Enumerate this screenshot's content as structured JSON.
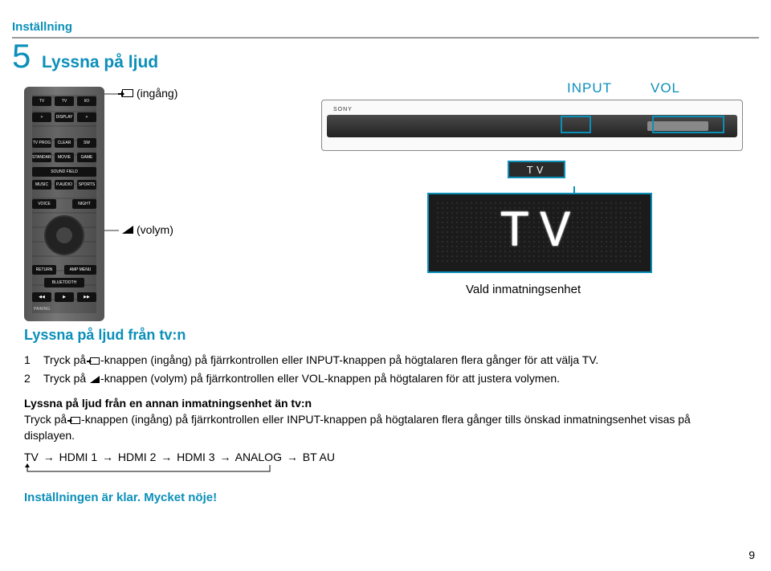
{
  "header": {
    "title": "Inställning"
  },
  "step": {
    "number": "5",
    "title": "Lyssna på ljud"
  },
  "callouts": {
    "input_label": "(ingång)",
    "volume_label": "(volym)"
  },
  "soundbar": {
    "brand": "SONY",
    "label_input": "INPUT",
    "label_vol": "VOL",
    "display_small": "TV",
    "display_big": "TV",
    "caption": "Vald inmatningsenhet"
  },
  "section": {
    "title": "Lyssna på ljud från tv:n",
    "step1_num": "1",
    "step1_lead": "Tryck på ",
    "step1_tail": "-knappen (ingång) på fjärrkontrollen eller INPUT-knappen på högtalaren flera gånger för att välja TV.",
    "step2_num": "2",
    "step2_lead": "Tryck på ",
    "step2_tail": "-knappen (volym) på fjärrkontrollen eller VOL-knappen på högtalaren för att justera volymen.",
    "sub_title": "Lyssna på ljud från en annan inmatningsenhet än tv:n",
    "sub_lead": "Tryck på ",
    "sub_tail": "-knappen (ingång) på fjärrkontrollen eller INPUT-knappen på högtalaren flera gånger tills önskad inmatningsenhet visas på displayen.",
    "sequence": [
      "TV",
      "HDMI 1",
      "HDMI 2",
      "HDMI 3",
      "ANALOG",
      "BT AU"
    ],
    "arrow": "→",
    "done": "Inställningen är klar. Mycket nöje!"
  },
  "remote": {
    "buttons_row1": [
      "TV",
      "TV",
      "I/⏻"
    ],
    "buttons_row2": [
      "+",
      "DISPLAY",
      "+"
    ],
    "buttons_row4": [
      "TV PROG",
      "CLEAR AUDIO+",
      "SW"
    ],
    "buttons_row5": [
      "STANDARD",
      "MOVIE",
      "GAME"
    ],
    "buttons_row6": [
      "",
      "SOUND FIELD",
      ""
    ],
    "buttons_row7": [
      "MUSIC",
      "P.AUDIO",
      "SPORTS"
    ],
    "voice": "VOICE",
    "night": "NIGHT",
    "return_label": "RETURN",
    "amp_menu": "AMP MENU",
    "bluetooth": "BLUETOOTH",
    "media": [
      "◀◀",
      "▶",
      "▶▶"
    ],
    "pairing": "PAIRING"
  },
  "page_number": "9"
}
